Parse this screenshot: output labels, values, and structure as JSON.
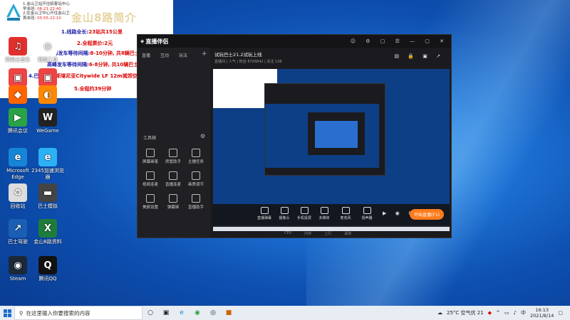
{
  "overlay": {
    "top_lines": [
      {
        "label": "1.金山卫站开往临客站中心",
        "time": ""
      },
      {
        "label": "早末班:",
        "time": "06:21-22:40"
      },
      {
        "label": "2.往金山卫中心开往金山卫",
        "time": ""
      },
      {
        "label": "首末班:",
        "time": "05:55-22:10"
      }
    ],
    "big_title": "金山8路简介",
    "items": [
      {
        "key": "1.线路全长:",
        "val": "23站共15公里"
      },
      {
        "key": "",
        "val": "2.全程票价:2元"
      },
      {
        "key": "3.平峰发车等待间隔:",
        "val": "8-10分钟, 共8辆巴士"
      },
      {
        "key": "高峰发车等待间隔:",
        "val": "6-8分钟, 共10辆巴士"
      },
      {
        "key": "4.巴士配置:",
        "val": "斯堪尼亚Citywide LF 12m城郊空调电动巴士"
      },
      {
        "key": "",
        "val": "5.全程约39分钟"
      }
    ]
  },
  "desktop_icons": [
    {
      "name": "desktop-icon-netease-music",
      "label": "网易云音乐",
      "glyph": "♫",
      "color": "#e0302d"
    },
    {
      "name": "desktop-icon-screenshot",
      "label": "截图工具",
      "glyph": "◎",
      "color": "#ffffff"
    },
    {
      "name": "desktop-icon-app3",
      "label": "",
      "glyph": "▣",
      "color": "#e44"
    },
    {
      "name": "desktop-icon-app4",
      "label": "",
      "glyph": "▣",
      "color": "#e44"
    },
    {
      "name": "desktop-icon-qq-game",
      "label": "",
      "glyph": "◆",
      "color": "#f60"
    },
    {
      "name": "desktop-icon-paint",
      "label": "",
      "glyph": "◐",
      "color": "#f80"
    },
    {
      "name": "desktop-icon-tencent-meeting",
      "label": "腾讯会议",
      "glyph": "▶",
      "color": "#2ba245"
    },
    {
      "name": "desktop-icon-wegame",
      "label": "WeGame",
      "glyph": "W",
      "color": "#222"
    },
    {
      "name": "desktop-icon-edge",
      "label": "Microsoft Edge",
      "glyph": "e",
      "color": "#1785d7"
    },
    {
      "name": "desktop-icon-360-browser",
      "label": "2345加速浏览器",
      "glyph": "e",
      "color": "#2db1f5"
    },
    {
      "name": "desktop-icon-recycle-bin",
      "label": "回收站",
      "glyph": "♻",
      "color": "#ddd"
    },
    {
      "name": "desktop-icon-omsi",
      "label": "巴士模拟",
      "glyph": "▬",
      "color": "#444"
    },
    {
      "name": "desktop-icon-bus-sim",
      "label": "巴士驾驶",
      "glyph": "↗",
      "color": "#1a5fb4"
    },
    {
      "name": "desktop-icon-excel-file",
      "label": "金山8路资料",
      "glyph": "X",
      "color": "#1e7c3b"
    },
    {
      "name": "desktop-icon-steam",
      "label": "Steam",
      "glyph": "◉",
      "color": "#1b2838"
    },
    {
      "name": "desktop-icon-qq",
      "label": "腾讯QQ",
      "glyph": "Q",
      "color": "#111"
    }
  ],
  "live_window": {
    "brand": "直播伴侣",
    "tabs": [
      "直播",
      "互动",
      "玩法",
      "设置"
    ],
    "toolbox_label": "工具箱",
    "tools": [
      "屏幕画笔",
      "房管助手",
      "主播任务",
      "视频连麦",
      "直播连麦",
      "画质调节",
      "美颜设置",
      "弹幕姬",
      "直播助手"
    ],
    "stream_title": "试玩巴士21.2试玩上线",
    "stream_sub": "直播间 | 人气 | 粉丝 8726842 | 关注 138",
    "controls": [
      "直播弹幕",
      "摄像头",
      "手机投屏",
      "多媒体",
      "麦克风",
      "扬声器"
    ],
    "start_live": "开始直播(F1)",
    "status": [
      "CPU",
      "内存",
      "上行",
      "丢帧"
    ]
  },
  "taskbar": {
    "search_placeholder": "在这里输入你要搜索的内容",
    "weather": "25°C 空气优 21",
    "time": "16:13",
    "date": "2021/8/14"
  },
  "colors": {
    "accent_live": "#ff7b1c",
    "overlay_red": "#d00",
    "overlay_blue": "#1a1aa8"
  }
}
